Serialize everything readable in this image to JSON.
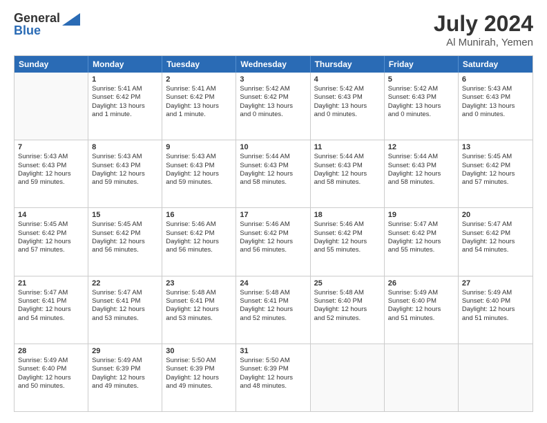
{
  "logo": {
    "line1": "General",
    "line2": "Blue",
    "arrow_color": "#2a6bb5"
  },
  "title": "July 2024",
  "location": "Al Munirah, Yemen",
  "weekdays": [
    "Sunday",
    "Monday",
    "Tuesday",
    "Wednesday",
    "Thursday",
    "Friday",
    "Saturday"
  ],
  "rows": [
    [
      {
        "day": "",
        "lines": []
      },
      {
        "day": "1",
        "lines": [
          "Sunrise: 5:41 AM",
          "Sunset: 6:42 PM",
          "Daylight: 13 hours",
          "and 1 minute."
        ]
      },
      {
        "day": "2",
        "lines": [
          "Sunrise: 5:41 AM",
          "Sunset: 6:42 PM",
          "Daylight: 13 hours",
          "and 1 minute."
        ]
      },
      {
        "day": "3",
        "lines": [
          "Sunrise: 5:42 AM",
          "Sunset: 6:42 PM",
          "Daylight: 13 hours",
          "and 0 minutes."
        ]
      },
      {
        "day": "4",
        "lines": [
          "Sunrise: 5:42 AM",
          "Sunset: 6:43 PM",
          "Daylight: 13 hours",
          "and 0 minutes."
        ]
      },
      {
        "day": "5",
        "lines": [
          "Sunrise: 5:42 AM",
          "Sunset: 6:43 PM",
          "Daylight: 13 hours",
          "and 0 minutes."
        ]
      },
      {
        "day": "6",
        "lines": [
          "Sunrise: 5:43 AM",
          "Sunset: 6:43 PM",
          "Daylight: 13 hours",
          "and 0 minutes."
        ]
      }
    ],
    [
      {
        "day": "7",
        "lines": [
          "Sunrise: 5:43 AM",
          "Sunset: 6:43 PM",
          "Daylight: 12 hours",
          "and 59 minutes."
        ]
      },
      {
        "day": "8",
        "lines": [
          "Sunrise: 5:43 AM",
          "Sunset: 6:43 PM",
          "Daylight: 12 hours",
          "and 59 minutes."
        ]
      },
      {
        "day": "9",
        "lines": [
          "Sunrise: 5:43 AM",
          "Sunset: 6:43 PM",
          "Daylight: 12 hours",
          "and 59 minutes."
        ]
      },
      {
        "day": "10",
        "lines": [
          "Sunrise: 5:44 AM",
          "Sunset: 6:43 PM",
          "Daylight: 12 hours",
          "and 58 minutes."
        ]
      },
      {
        "day": "11",
        "lines": [
          "Sunrise: 5:44 AM",
          "Sunset: 6:43 PM",
          "Daylight: 12 hours",
          "and 58 minutes."
        ]
      },
      {
        "day": "12",
        "lines": [
          "Sunrise: 5:44 AM",
          "Sunset: 6:43 PM",
          "Daylight: 12 hours",
          "and 58 minutes."
        ]
      },
      {
        "day": "13",
        "lines": [
          "Sunrise: 5:45 AM",
          "Sunset: 6:42 PM",
          "Daylight: 12 hours",
          "and 57 minutes."
        ]
      }
    ],
    [
      {
        "day": "14",
        "lines": [
          "Sunrise: 5:45 AM",
          "Sunset: 6:42 PM",
          "Daylight: 12 hours",
          "and 57 minutes."
        ]
      },
      {
        "day": "15",
        "lines": [
          "Sunrise: 5:45 AM",
          "Sunset: 6:42 PM",
          "Daylight: 12 hours",
          "and 56 minutes."
        ]
      },
      {
        "day": "16",
        "lines": [
          "Sunrise: 5:46 AM",
          "Sunset: 6:42 PM",
          "Daylight: 12 hours",
          "and 56 minutes."
        ]
      },
      {
        "day": "17",
        "lines": [
          "Sunrise: 5:46 AM",
          "Sunset: 6:42 PM",
          "Daylight: 12 hours",
          "and 56 minutes."
        ]
      },
      {
        "day": "18",
        "lines": [
          "Sunrise: 5:46 AM",
          "Sunset: 6:42 PM",
          "Daylight: 12 hours",
          "and 55 minutes."
        ]
      },
      {
        "day": "19",
        "lines": [
          "Sunrise: 5:47 AM",
          "Sunset: 6:42 PM",
          "Daylight: 12 hours",
          "and 55 minutes."
        ]
      },
      {
        "day": "20",
        "lines": [
          "Sunrise: 5:47 AM",
          "Sunset: 6:42 PM",
          "Daylight: 12 hours",
          "and 54 minutes."
        ]
      }
    ],
    [
      {
        "day": "21",
        "lines": [
          "Sunrise: 5:47 AM",
          "Sunset: 6:41 PM",
          "Daylight: 12 hours",
          "and 54 minutes."
        ]
      },
      {
        "day": "22",
        "lines": [
          "Sunrise: 5:47 AM",
          "Sunset: 6:41 PM",
          "Daylight: 12 hours",
          "and 53 minutes."
        ]
      },
      {
        "day": "23",
        "lines": [
          "Sunrise: 5:48 AM",
          "Sunset: 6:41 PM",
          "Daylight: 12 hours",
          "and 53 minutes."
        ]
      },
      {
        "day": "24",
        "lines": [
          "Sunrise: 5:48 AM",
          "Sunset: 6:41 PM",
          "Daylight: 12 hours",
          "and 52 minutes."
        ]
      },
      {
        "day": "25",
        "lines": [
          "Sunrise: 5:48 AM",
          "Sunset: 6:40 PM",
          "Daylight: 12 hours",
          "and 52 minutes."
        ]
      },
      {
        "day": "26",
        "lines": [
          "Sunrise: 5:49 AM",
          "Sunset: 6:40 PM",
          "Daylight: 12 hours",
          "and 51 minutes."
        ]
      },
      {
        "day": "27",
        "lines": [
          "Sunrise: 5:49 AM",
          "Sunset: 6:40 PM",
          "Daylight: 12 hours",
          "and 51 minutes."
        ]
      }
    ],
    [
      {
        "day": "28",
        "lines": [
          "Sunrise: 5:49 AM",
          "Sunset: 6:40 PM",
          "Daylight: 12 hours",
          "and 50 minutes."
        ]
      },
      {
        "day": "29",
        "lines": [
          "Sunrise: 5:49 AM",
          "Sunset: 6:39 PM",
          "Daylight: 12 hours",
          "and 49 minutes."
        ]
      },
      {
        "day": "30",
        "lines": [
          "Sunrise: 5:50 AM",
          "Sunset: 6:39 PM",
          "Daylight: 12 hours",
          "and 49 minutes."
        ]
      },
      {
        "day": "31",
        "lines": [
          "Sunrise: 5:50 AM",
          "Sunset: 6:39 PM",
          "Daylight: 12 hours",
          "and 48 minutes."
        ]
      },
      {
        "day": "",
        "lines": []
      },
      {
        "day": "",
        "lines": []
      },
      {
        "day": "",
        "lines": []
      }
    ]
  ]
}
